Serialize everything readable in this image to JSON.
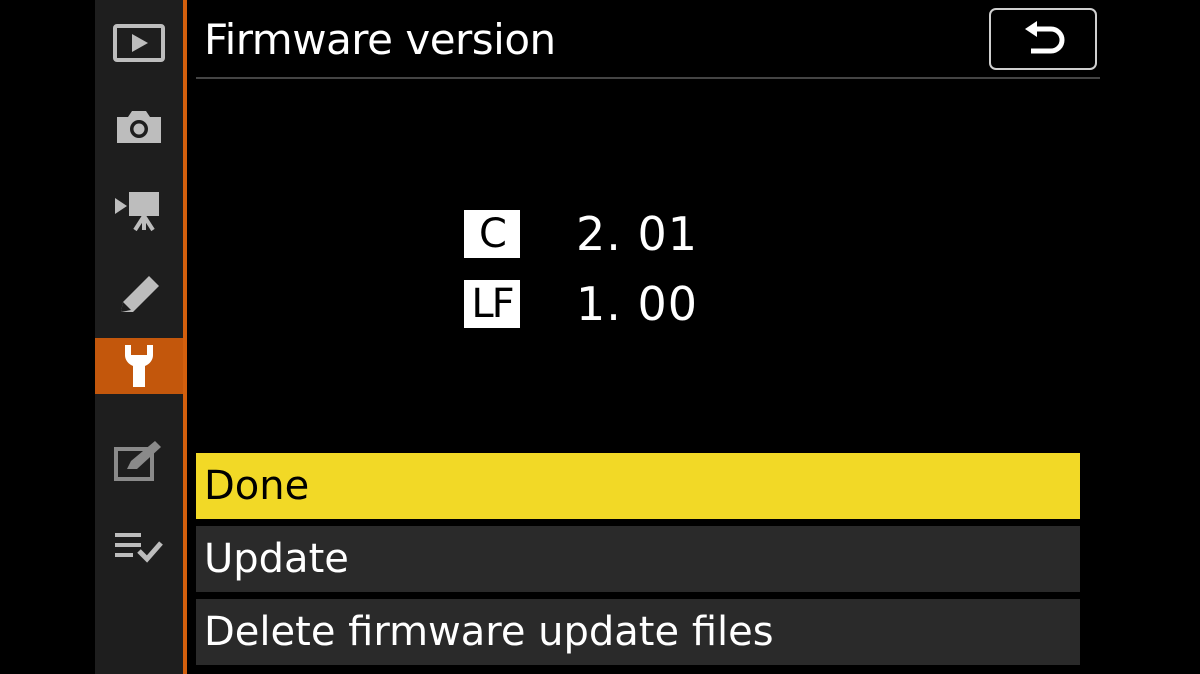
{
  "header": {
    "title": "Firmware version",
    "back_icon": "return-arrow-icon"
  },
  "sidebar": {
    "items": [
      {
        "icon": "playback-icon",
        "active": false
      },
      {
        "icon": "camera-icon",
        "active": false
      },
      {
        "icon": "movie-camera-icon",
        "active": false
      },
      {
        "icon": "pencil-icon",
        "active": false
      },
      {
        "icon": "wrench-icon",
        "active": true
      },
      {
        "icon": "retouch-icon",
        "active": false
      },
      {
        "icon": "my-menu-icon",
        "active": false
      }
    ],
    "active_color": "#c3570c",
    "accent_color": "#d35f0d"
  },
  "firmware": [
    {
      "label": "C",
      "value": "2. 01"
    },
    {
      "label": "LF",
      "value": "1. 00"
    }
  ],
  "menu": {
    "items": [
      {
        "label": "Done",
        "selected": true
      },
      {
        "label": "Update",
        "selected": false
      },
      {
        "label": "Delete firmware update files",
        "selected": false
      }
    ],
    "selected_color": "#f2d926"
  }
}
